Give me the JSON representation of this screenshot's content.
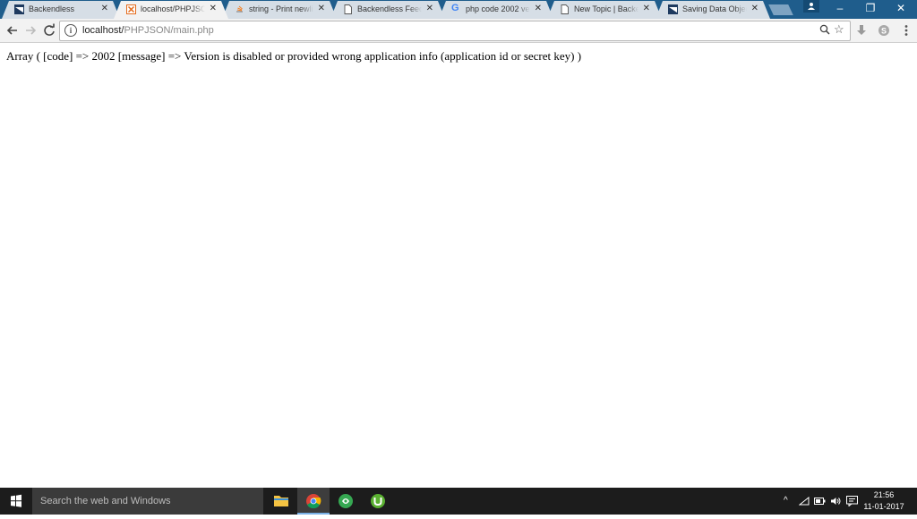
{
  "browser": {
    "tabs": [
      {
        "title": "Backendless",
        "icon": "backendless-icon"
      },
      {
        "title": "localhost/PHPJSON",
        "icon": "xampp-icon",
        "active": true
      },
      {
        "title": "string - Print newlin",
        "icon": "stackoverflow-icon"
      },
      {
        "title": "Backendless Feedb",
        "icon": "page-icon"
      },
      {
        "title": "php code 2002 ver",
        "icon": "google-icon"
      },
      {
        "title": "New Topic | Backer",
        "icon": "page-icon"
      },
      {
        "title": "Saving Data Object",
        "icon": "backendless-icon"
      }
    ],
    "address": {
      "host": "localhost/",
      "path": "PHPJSON/main.php"
    }
  },
  "page": {
    "output": "Array ( [code] => 2002 [message] => Version is disabled or provided wrong application info (application id or secret key) )"
  },
  "taskbar": {
    "search_placeholder": "Search the web and Windows",
    "time": "21:56",
    "date": "11-01-2017"
  },
  "colors": {
    "tabstrip": "#1f5d8c",
    "toolbar": "#f2f2f2",
    "taskbar": "#1c1c1c",
    "accent": "#7ab1e6"
  }
}
